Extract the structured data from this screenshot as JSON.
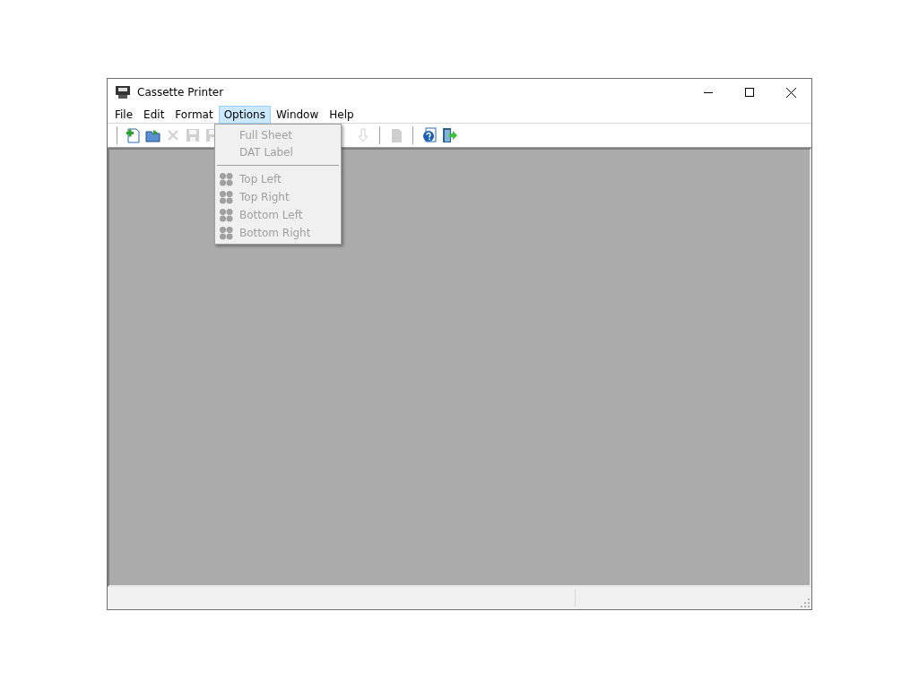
{
  "window": {
    "title": "Cassette Printer"
  },
  "menu_bar": [
    {
      "label": "File",
      "selected": false
    },
    {
      "label": "Edit",
      "selected": false
    },
    {
      "label": "Format",
      "selected": false
    },
    {
      "label": "Options",
      "selected": true
    },
    {
      "label": "Window",
      "selected": false
    },
    {
      "label": "Help",
      "selected": false
    }
  ],
  "toolbar": [
    {
      "kind": "separator"
    },
    {
      "kind": "new",
      "disabled": false
    },
    {
      "kind": "open",
      "disabled": false
    },
    {
      "kind": "delete",
      "disabled": true
    },
    {
      "kind": "save",
      "disabled": true
    },
    {
      "kind": "save",
      "disabled": true
    },
    {
      "kind": "hidden"
    },
    {
      "kind": "down",
      "disabled": true
    },
    {
      "kind": "separator"
    },
    {
      "kind": "page",
      "disabled": true
    },
    {
      "kind": "separator"
    },
    {
      "kind": "help",
      "disabled": false
    },
    {
      "kind": "exit",
      "disabled": false
    }
  ],
  "options_menu": [
    {
      "kind": "item",
      "label": "Full Sheet",
      "disabled": true
    },
    {
      "kind": "item",
      "label": "DAT Label",
      "disabled": true
    },
    {
      "kind": "separator"
    },
    {
      "kind": "quadrant",
      "label": "Top Left",
      "disabled": true
    },
    {
      "kind": "quadrant",
      "label": "Top Right",
      "disabled": true
    },
    {
      "kind": "quadrant",
      "label": "Bottom Left",
      "disabled": true
    },
    {
      "kind": "quadrant",
      "label": "Bottom Right",
      "disabled": true
    }
  ]
}
